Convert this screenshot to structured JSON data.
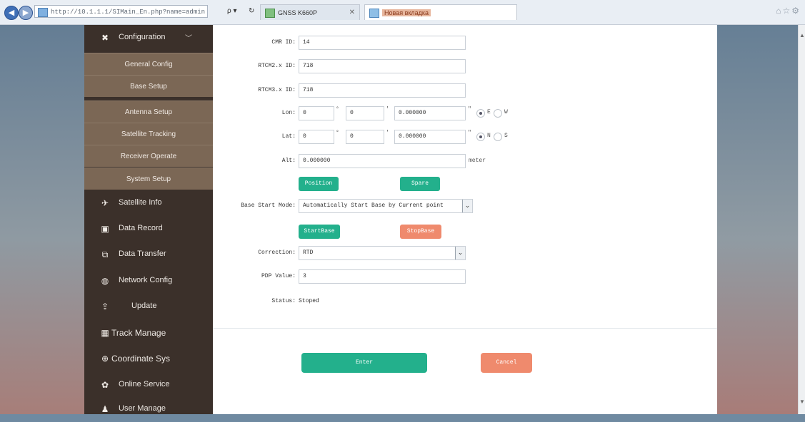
{
  "browser": {
    "address": "http://10.1.1.1/SIMain_En.php?name=admin",
    "tabs": [
      {
        "label": "GNSS K660P"
      },
      {
        "label": "Новая вкладка"
      }
    ],
    "tools_search": "ρ ▾",
    "tools_refresh": "↻"
  },
  "sidebar": {
    "configuration": {
      "label": "Configuration",
      "icon": "tools-icon"
    },
    "sub_items": [
      {
        "label": "General Config"
      },
      {
        "label": "Base Setup"
      },
      {
        "label": "Antenna Setup"
      },
      {
        "label": "Satellite Tracking"
      },
      {
        "label": "Receiver Operate"
      },
      {
        "label": "System Setup"
      }
    ],
    "items": [
      {
        "label": "Satellite Info",
        "icon": "satellite-icon",
        "glyph": "✈"
      },
      {
        "label": "Data Record",
        "icon": "data-record-icon",
        "glyph": "▣"
      },
      {
        "label": "Data Transfer",
        "icon": "data-transfer-icon",
        "glyph": "⧉"
      },
      {
        "label": "Network Config",
        "icon": "network-icon",
        "glyph": "◍"
      },
      {
        "label": "Update",
        "icon": "update-icon",
        "glyph": "⇪"
      },
      {
        "label": "Track Manage",
        "icon": "track-manage-icon",
        "glyph": "▦"
      },
      {
        "label": "Coordinate Sys",
        "icon": "coordinate-icon",
        "glyph": "⊕"
      },
      {
        "label": "Online Service",
        "icon": "online-service-icon",
        "glyph": "✿"
      },
      {
        "label": "User Manage",
        "icon": "user-manage-icon",
        "glyph": "♟"
      }
    ]
  },
  "form": {
    "cmr_id": {
      "label": "CMR ID:",
      "value": "14"
    },
    "rtcm2_id": {
      "label": "RTCM2.x ID:",
      "value": "718"
    },
    "rtcm3_id": {
      "label": "RTCM3.x ID:",
      "value": "718"
    },
    "lon": {
      "label": "Lon:",
      "deg": "0",
      "min": "0",
      "sec": "0.000000",
      "deg_unit": "°",
      "min_unit": "'",
      "sec_unit": "\"",
      "dir_options": [
        "E",
        "W"
      ],
      "selected": "E"
    },
    "lat": {
      "label": "Lat:",
      "deg": "0",
      "min": "0",
      "sec": "0.000000",
      "deg_unit": "°",
      "min_unit": "'",
      "sec_unit": "\"",
      "dir_options": [
        "N",
        "S"
      ],
      "selected": "N"
    },
    "alt": {
      "label": "Alt:",
      "value": "0.000000",
      "unit": "meter"
    },
    "position_button": "Position",
    "spare_button": "Spare",
    "base_start_mode": {
      "label": "Base Start Mode:",
      "value": "Automatically Start Base by Current point"
    },
    "start_base_button": "StartBase",
    "stop_base_button": "StopBase",
    "correction": {
      "label": "Correction:",
      "value": "RTD"
    },
    "pdp_value": {
      "label": "PDP Value:",
      "value": "3"
    },
    "status": {
      "label": "Status:",
      "value": "Stoped"
    },
    "enter_button": "Enter",
    "cancel_button": "Cancel"
  },
  "colors": {
    "accent_green": "#23b08c",
    "accent_orange": "#ef8a6d",
    "sidebar_dark": "#3b302a",
    "submenu": "#7b6755"
  }
}
